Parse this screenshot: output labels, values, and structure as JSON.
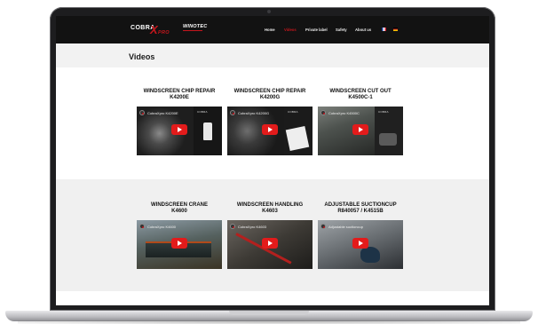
{
  "brand": {
    "logo_text": "COBRA",
    "logo_x": "X",
    "logo_suffix": "PRO",
    "partner_logo": "WINOTEC"
  },
  "nav": {
    "items": [
      {
        "label": "Home",
        "active": false
      },
      {
        "label": "Videos",
        "active": true
      },
      {
        "label": "Private label",
        "active": false
      },
      {
        "label": "Safety",
        "active": false
      },
      {
        "label": "About us",
        "active": false
      }
    ],
    "languages": [
      "fr-flag-icon",
      "de-flag-icon"
    ]
  },
  "page": {
    "title": "Videos"
  },
  "videos": [
    {
      "title_line1": "WINDSCREEN CHIP REPAIR",
      "title_line2": "K4200E",
      "overlay": "CobraXpro K4200E",
      "brand": "COBRA"
    },
    {
      "title_line1": "WINDSCREEN CHIP REPAIR",
      "title_line2": "K4200G",
      "overlay": "CobraXpro K4200G",
      "brand": "COBRA"
    },
    {
      "title_line1": "WINDSCREEN CUT OUT",
      "title_line2": "K4500C-1",
      "overlay": "CobraXpro K4500C",
      "brand": "COBRA"
    },
    {
      "title_line1": "WINDSCREEN CRANE",
      "title_line2": "K4600",
      "overlay": "CobraXpro K4600",
      "brand": ""
    },
    {
      "title_line1": "WINDSCREEN HANDLING",
      "title_line2": "K4603",
      "overlay": "CobraXpro K4603",
      "brand": ""
    },
    {
      "title_line1": "ADJUSTABLE SUCTIONCUP",
      "title_line2": "R840057 / K4515B",
      "overlay": "Adjustable suctioncup",
      "brand": ""
    }
  ],
  "colors": {
    "accent": "#c4161c",
    "nav_bg": "#121212",
    "play": "#e31b1b"
  }
}
